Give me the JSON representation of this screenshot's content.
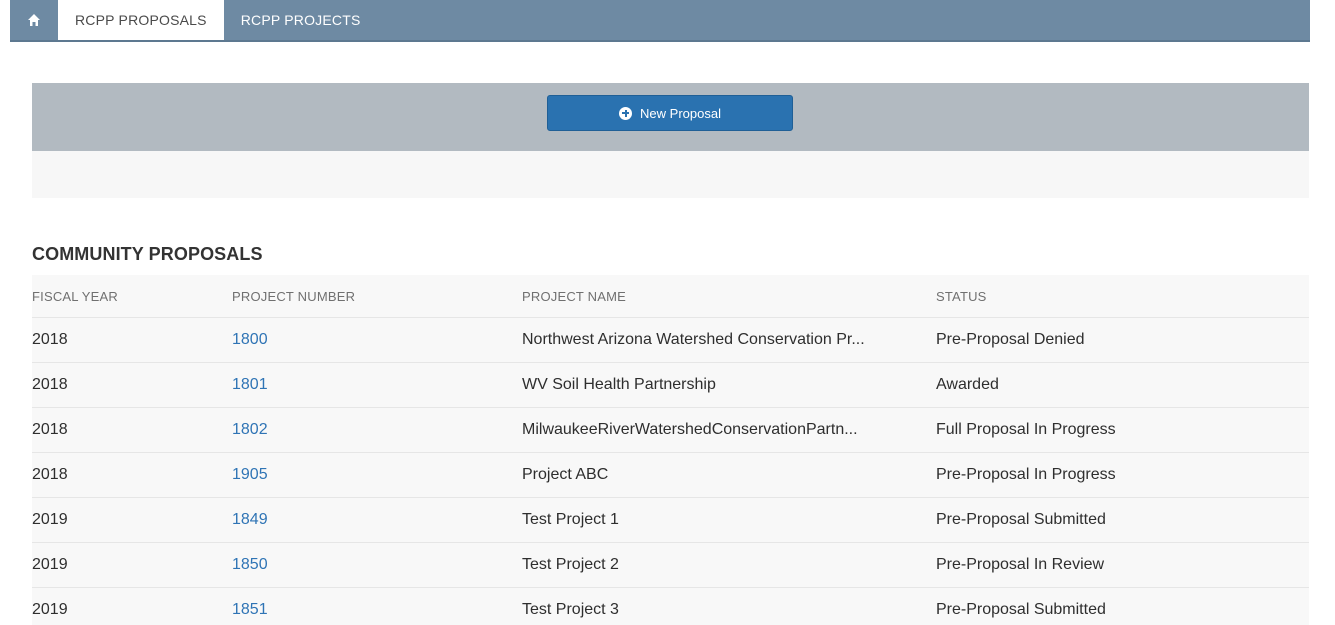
{
  "nav": {
    "home_icon": "home-icon",
    "tabs": [
      {
        "label": "RCPP PROPOSALS",
        "active": true
      },
      {
        "label": "RCPP PROJECTS",
        "active": false
      }
    ]
  },
  "actions": {
    "new_proposal_label": "New Proposal",
    "new_proposal_icon": "plus-circle-icon"
  },
  "section": {
    "title": "COMMUNITY PROPOSALS"
  },
  "table": {
    "columns": [
      "FISCAL YEAR",
      "PROJECT NUMBER",
      "PROJECT NAME",
      "STATUS"
    ],
    "rows": [
      {
        "fiscal_year": "2018",
        "project_number": "1800",
        "project_name": "Northwest Arizona Watershed Conservation Pr...",
        "status": "Pre-Proposal Denied"
      },
      {
        "fiscal_year": "2018",
        "project_number": "1801",
        "project_name": "WV Soil Health Partnership",
        "status": "Awarded"
      },
      {
        "fiscal_year": "2018",
        "project_number": "1802",
        "project_name": "MilwaukeeRiverWatershedConservationPartn...",
        "status": "Full Proposal In Progress"
      },
      {
        "fiscal_year": "2018",
        "project_number": "1905",
        "project_name": "Project ABC",
        "status": "Pre-Proposal In Progress"
      },
      {
        "fiscal_year": "2019",
        "project_number": "1849",
        "project_name": "Test Project 1",
        "status": "Pre-Proposal Submitted"
      },
      {
        "fiscal_year": "2019",
        "project_number": "1850",
        "project_name": "Test Project 2",
        "status": "Pre-Proposal In Review"
      },
      {
        "fiscal_year": "2019",
        "project_number": "1851",
        "project_name": "Test Project 3",
        "status": "Pre-Proposal Submitted"
      }
    ]
  },
  "colors": {
    "nav_bg": "#6e8aa3",
    "action_band": "#b2bac1",
    "button": "#2a72b0",
    "link": "#2f74b5"
  }
}
